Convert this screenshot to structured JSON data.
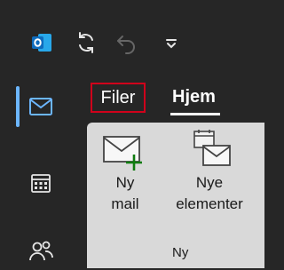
{
  "ribbon": {
    "tabs": [
      {
        "label": "Filer",
        "highlighted": true
      },
      {
        "label": "Hjem",
        "active": true
      }
    ],
    "new_mail": {
      "line1": "Ny",
      "line2": "mail"
    },
    "new_items": {
      "line1": "Nye",
      "line2": "elementer"
    },
    "group_label": "Ny"
  },
  "colors": {
    "background": "#262626",
    "ribbon": "#d9d9d9",
    "accent": "#6cb6ff",
    "highlight_border": "#d0021b",
    "outlook_blue": "#0f6cbd"
  },
  "icons": [
    "outlook-app-icon",
    "sync-icon",
    "undo-icon",
    "customize-quick-access-icon",
    "mail-nav-icon",
    "calendar-nav-icon",
    "people-nav-icon",
    "new-mail-icon",
    "new-items-icon"
  ]
}
